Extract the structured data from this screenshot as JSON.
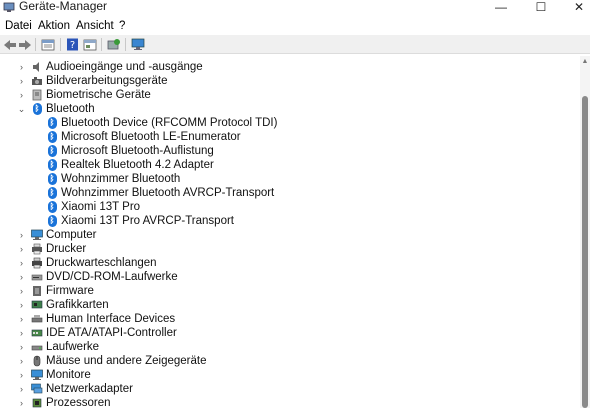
{
  "window": {
    "title": "Geräte-Manager",
    "minimize_glyph": "—",
    "maximize_glyph": "☐",
    "close_glyph": "✕"
  },
  "menu": {
    "items": [
      "Datei",
      "Aktion",
      "Ansicht",
      "?"
    ]
  },
  "toolbar": {
    "icons": [
      "back-arrow-icon",
      "forward-arrow-icon",
      "properties-icon",
      "help-icon",
      "details-icon",
      "update-driver-icon",
      "show-computer-icon"
    ]
  },
  "tree": {
    "categories": [
      {
        "label": "Audioeingänge und -ausgänge",
        "icon": "speaker-icon",
        "expanded": false
      },
      {
        "label": "Bildverarbeitungsgeräte",
        "icon": "camera-icon",
        "expanded": false
      },
      {
        "label": "Biometrische Geräte",
        "icon": "fingerprint-icon",
        "expanded": false
      },
      {
        "label": "Bluetooth",
        "icon": "bluetooth-icon",
        "expanded": true,
        "children": [
          "Bluetooth Device (RFCOMM Protocol TDI)",
          "Microsoft Bluetooth LE-Enumerator",
          "Microsoft Bluetooth-Auflistung",
          "Realtek Bluetooth 4.2 Adapter",
          "Wohnzimmer Bluetooth",
          "Wohnzimmer Bluetooth AVRCP-Transport",
          "Xiaomi 13T Pro",
          "Xiaomi 13T Pro AVRCP-Transport"
        ]
      },
      {
        "label": "Computer",
        "icon": "monitor-icon",
        "expanded": false
      },
      {
        "label": "Drucker",
        "icon": "printer-icon",
        "expanded": false
      },
      {
        "label": "Druckwarteschlangen",
        "icon": "print-queue-icon",
        "expanded": false
      },
      {
        "label": "DVD/CD-ROM-Laufwerke",
        "icon": "optical-drive-icon",
        "expanded": false
      },
      {
        "label": "Firmware",
        "icon": "firmware-icon",
        "expanded": false
      },
      {
        "label": "Grafikkarten",
        "icon": "display-adapter-icon",
        "expanded": false
      },
      {
        "label": "Human Interface Devices",
        "icon": "hid-icon",
        "expanded": false
      },
      {
        "label": "IDE ATA/ATAPI-Controller",
        "icon": "ide-controller-icon",
        "expanded": false
      },
      {
        "label": "Laufwerke",
        "icon": "disk-drive-icon",
        "expanded": false
      },
      {
        "label": "Mäuse und andere Zeigegeräte",
        "icon": "mouse-icon",
        "expanded": false
      },
      {
        "label": "Monitore",
        "icon": "monitor-icon",
        "expanded": false
      },
      {
        "label": "Netzwerkadapter",
        "icon": "network-adapter-icon",
        "expanded": false
      },
      {
        "label": "Prozessoren",
        "icon": "processor-icon",
        "expanded": false
      }
    ]
  },
  "colors": {
    "bluetooth_blue": "#1a73d9",
    "toolbar_bg": "#f0f0f0",
    "scroll_thumb": "#8a8a8a"
  }
}
